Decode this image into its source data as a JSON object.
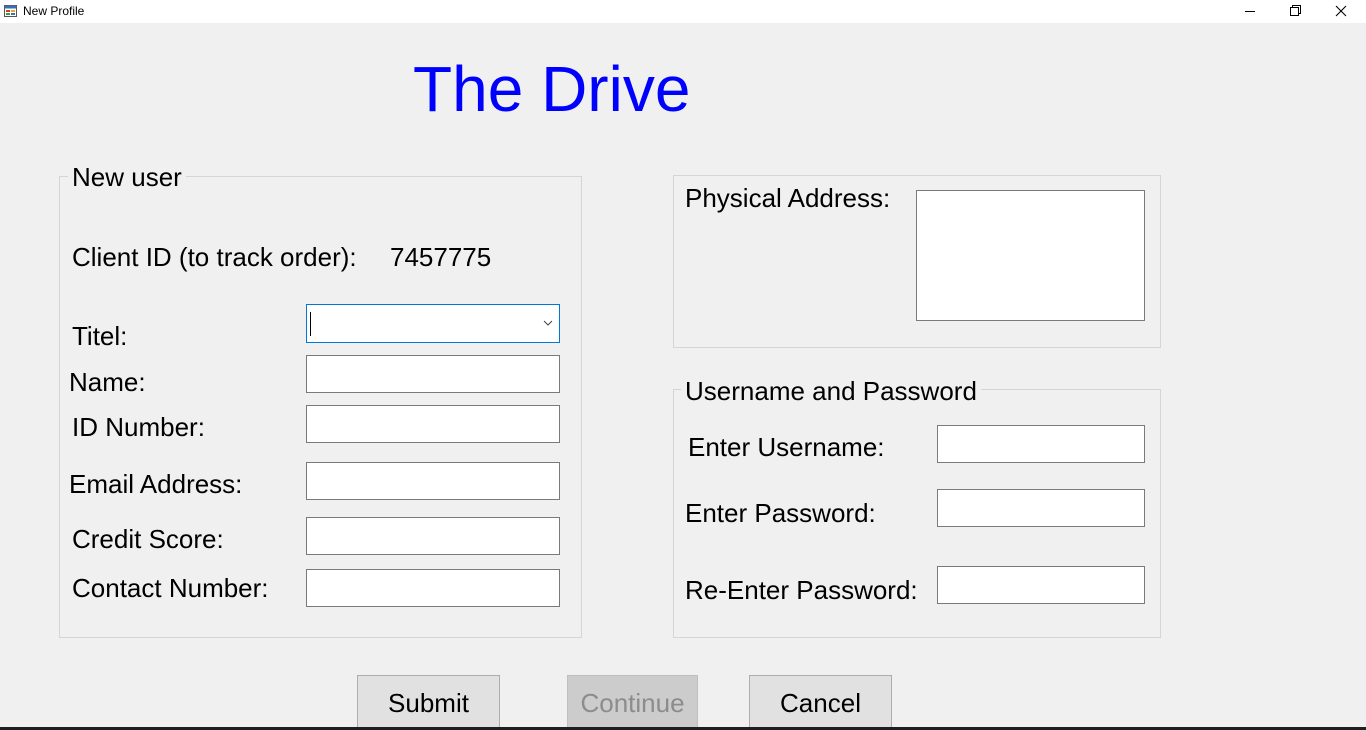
{
  "window": {
    "title": "New Profile",
    "icons": {
      "app": "form-app-icon",
      "minimize": "minimize-icon",
      "maximize": "restore-icon",
      "close": "close-icon"
    }
  },
  "heading": "The Drive",
  "new_user": {
    "legend": "New user",
    "client_id_label": "Client ID (to track order):",
    "client_id_value": "7457775",
    "title_label": "Titel:",
    "title_value": "",
    "name_label": "Name:",
    "name_value": "",
    "id_number_label": "ID Number:",
    "id_number_value": "",
    "email_label": "Email Address:",
    "email_value": "",
    "credit_score_label": "Credit Score:",
    "credit_score_value": "",
    "contact_label": "Contact Number:",
    "contact_value": ""
  },
  "address": {
    "label": "Physical Address:",
    "value": ""
  },
  "credentials": {
    "legend": "Username and Password",
    "username_label": "Enter Username:",
    "username_value": "",
    "password_label": "Enter Password:",
    "password_value": "",
    "reenter_label": "Re-Enter Password:",
    "reenter_value": ""
  },
  "buttons": {
    "submit": "Submit",
    "continue": "Continue",
    "cancel": "Cancel"
  },
  "colors": {
    "heading": "#0000ff",
    "focus_border": "#0078d7",
    "background": "#f0f0f0"
  }
}
